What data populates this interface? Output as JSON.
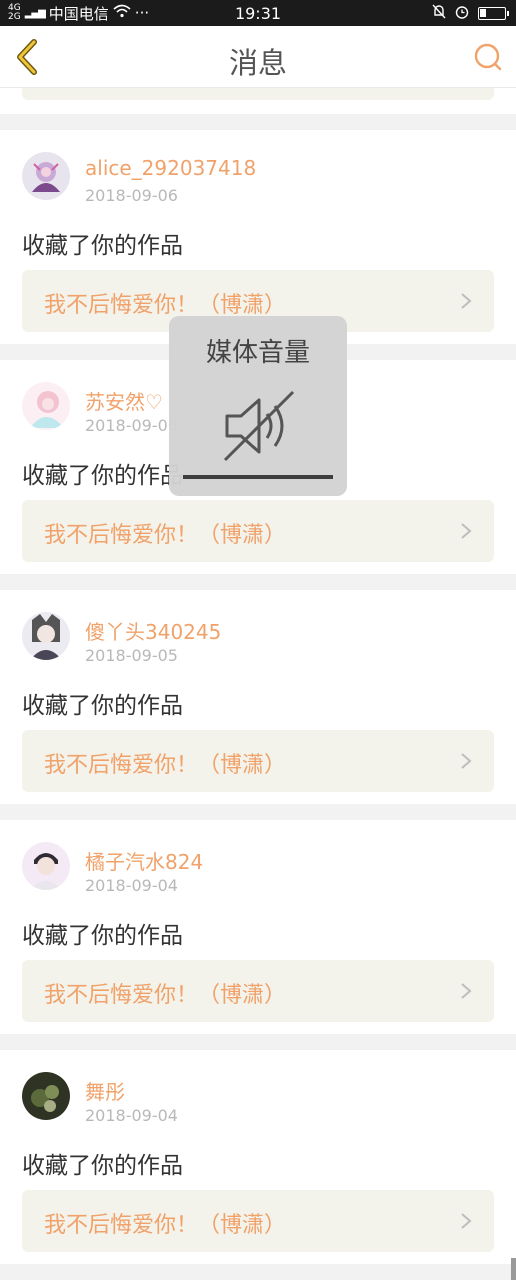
{
  "status_bar": {
    "network_top": "4G",
    "network_bottom": "2G",
    "carrier": "中国电信",
    "more": "···",
    "time": "19:31"
  },
  "header": {
    "title": "消息",
    "back_icon": "chevron-left-icon",
    "search_icon": "search-icon"
  },
  "accent_color": "#f0a26a",
  "messages": [
    {
      "username": "alice_292037418",
      "date": "2018-09-06",
      "action": "收藏了你的作品",
      "work_title": "我不后悔爱你！（博潇）"
    },
    {
      "username": "苏安然♡",
      "date": "2018-09-06",
      "action": "收藏了你的作品",
      "work_title": "我不后悔爱你！（博潇）"
    },
    {
      "username": "傻丫头340245",
      "date": "2018-09-05",
      "action": "收藏了你的作品",
      "work_title": "我不后悔爱你！（博潇）"
    },
    {
      "username": "橘子汽水824",
      "date": "2018-09-04",
      "action": "收藏了你的作品",
      "work_title": "我不后悔爱你！（博潇）"
    },
    {
      "username": "舞彤",
      "date": "2018-09-04",
      "action": "收藏了你的作品",
      "work_title": "我不后悔爱你！（博潇）"
    }
  ],
  "volume_overlay": {
    "label": "媒体音量",
    "icon": "speaker-muted-icon",
    "level": 0
  }
}
